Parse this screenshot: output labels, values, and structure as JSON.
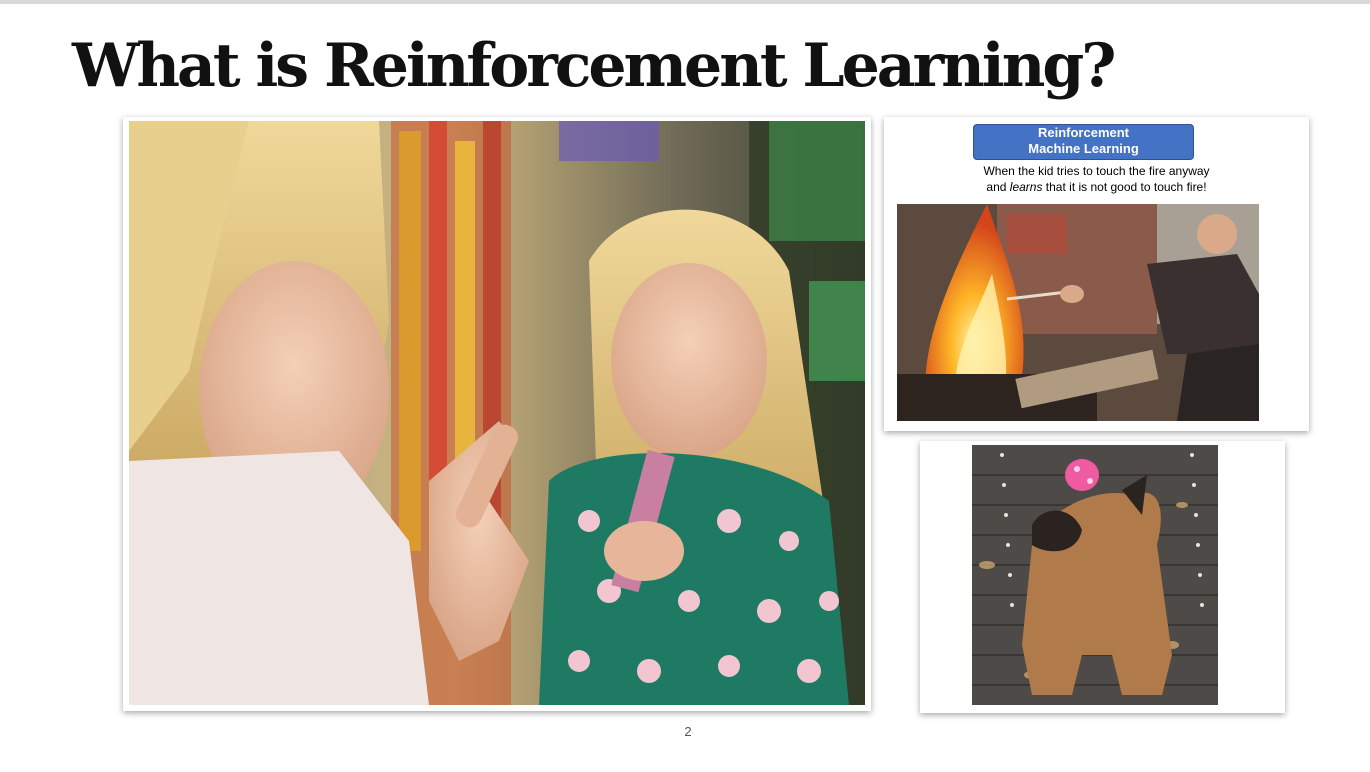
{
  "slide": {
    "title": "What is Reinforcement Learning?",
    "page_number": "2"
  },
  "rl_panel": {
    "badge_line1": "Reinforcement",
    "badge_line2": "Machine Learning",
    "caption_line1": "When the kid tries to touch the fire anyway",
    "caption_line2_pre": "and ",
    "caption_line2_em": "learns",
    "caption_line2_post": " that it is not good to touch fire!",
    "badge_color": "#4472c4"
  },
  "images": {
    "main": "mother-scolding-child-photo",
    "fire": "kid-touching-fire-photo",
    "dog": "dog-balancing-ball-photo"
  }
}
